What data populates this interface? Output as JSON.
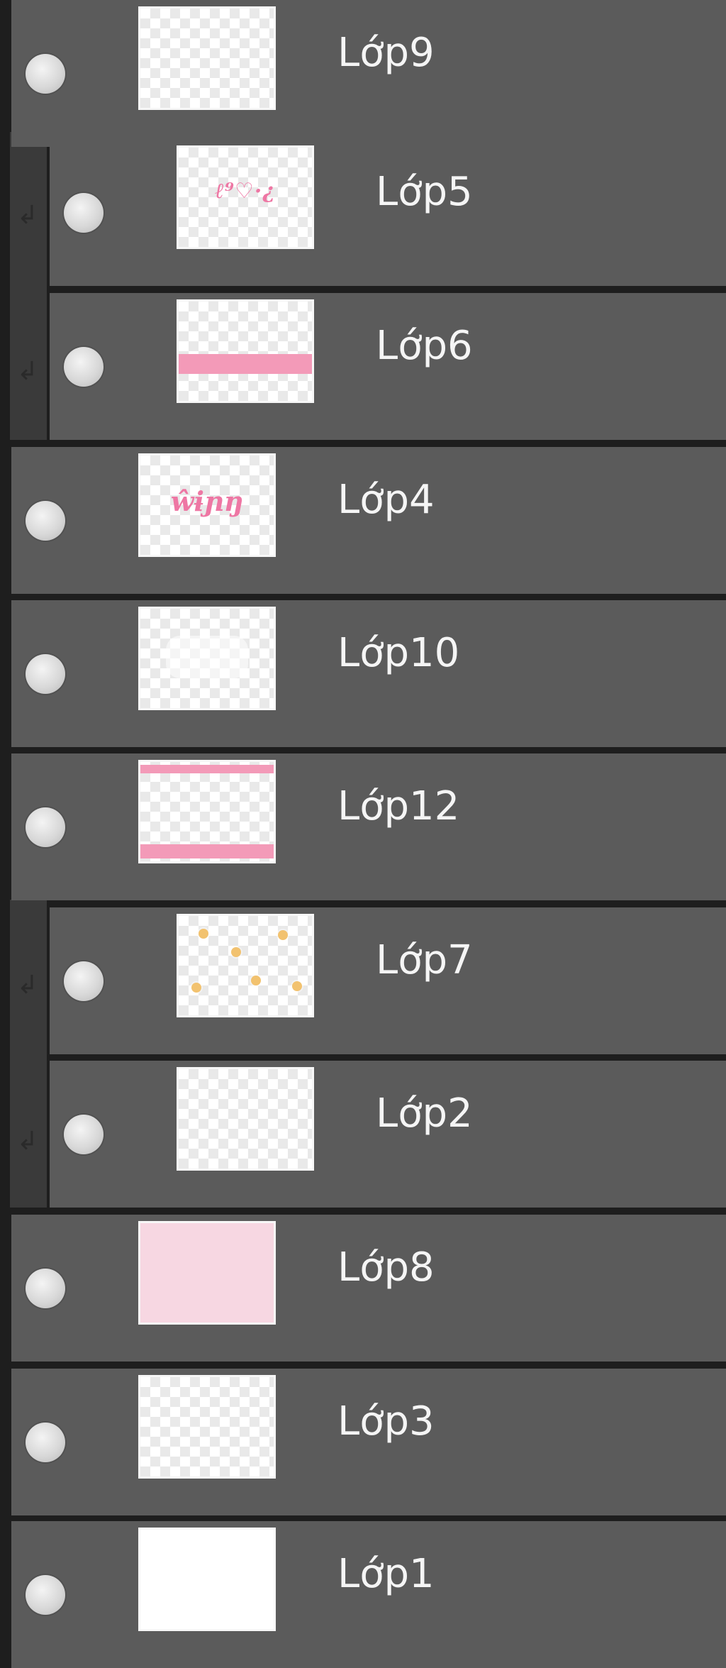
{
  "panel": {
    "layers": [
      {
        "name": "Lớp9",
        "type": "normal",
        "thumbnail": "transparent",
        "visible_icon": "visibility-toggle"
      },
      {
        "name": "Lớp5",
        "type": "clipped",
        "thumbnail": "pink-script-small",
        "thumb_text": "ℓ⁹♡·¿",
        "visible_icon": "visibility-toggle"
      },
      {
        "name": "Lớp6",
        "type": "clipped",
        "thumbnail": "pink-band",
        "visible_icon": "visibility-toggle"
      },
      {
        "name": "Lớp4",
        "type": "normal",
        "thumbnail": "pink-script-large",
        "thumb_text": "ŵɨɲŋ",
        "visible_icon": "visibility-toggle"
      },
      {
        "name": "Lớp10",
        "type": "normal",
        "thumbnail": "faint-white-shape",
        "visible_icon": "visibility-toggle"
      },
      {
        "name": "Lớp12",
        "type": "normal",
        "thumbnail": "pink-frame-bands",
        "visible_icon": "visibility-toggle"
      },
      {
        "name": "Lớp7",
        "type": "clipped",
        "thumbnail": "yellow-stars",
        "visible_icon": "visibility-toggle"
      },
      {
        "name": "Lớp2",
        "type": "clipped",
        "thumbnail": "transparent",
        "visible_icon": "visibility-toggle"
      },
      {
        "name": "Lớp8",
        "type": "normal",
        "thumbnail": "pink-fill",
        "visible_icon": "visibility-toggle"
      },
      {
        "name": "Lớp3",
        "type": "normal",
        "thumbnail": "transparent",
        "visible_icon": "visibility-toggle"
      },
      {
        "name": "Lớp1",
        "type": "normal",
        "thumbnail": "white-fill",
        "visible_icon": "visibility-toggle"
      }
    ]
  },
  "colors": {
    "panel_background": "#1e1e1e",
    "row_background": "#5b5b5b",
    "clip_strip": "#3a3a3a",
    "text": "#f5f5f5",
    "accent_pink": "#f39ab8",
    "accent_pink_text": "#ee77a4",
    "accent_yellow": "#f2c26f"
  },
  "icons": {
    "visibility": "eye-visibility-icon",
    "clipping": "clip-arrow-icon"
  }
}
